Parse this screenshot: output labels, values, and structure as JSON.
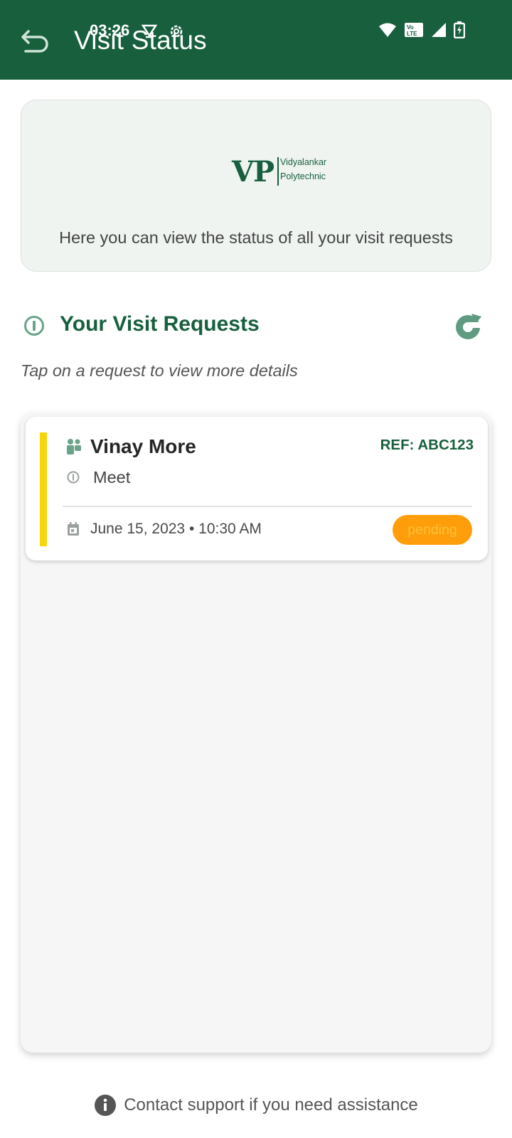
{
  "status_bar": {
    "time": "03:26",
    "icons": [
      "download-icon",
      "settings-icon",
      "wifi-icon",
      "volte-icon",
      "signal-icon",
      "battery-icon"
    ],
    "volte_label": "Vo LTE"
  },
  "header": {
    "title": "Visit Status",
    "back_icon": "back-arrow-icon",
    "background": "#175f3d"
  },
  "info_card": {
    "logo_mark": "VP",
    "logo_line1": "Vidyalankar",
    "logo_line2": "Polytechnic",
    "description": "Here you can view the status of all your visit requests"
  },
  "requests_section": {
    "title": "Your Visit Requests",
    "hint": "Tap on a request to view more details",
    "refresh_icon": "refresh-icon"
  },
  "requests": [
    {
      "name": "Vinay More",
      "ref": "REF: ABC123",
      "purpose": "Meet",
      "datetime": "June 15, 2023 • 10:30 AM",
      "status": "pending",
      "accent_color": "#f6d60a",
      "status_color": "#ff9d0a"
    }
  ],
  "footer": {
    "text": "Contact support if you need assistance",
    "icon": "info-icon"
  }
}
